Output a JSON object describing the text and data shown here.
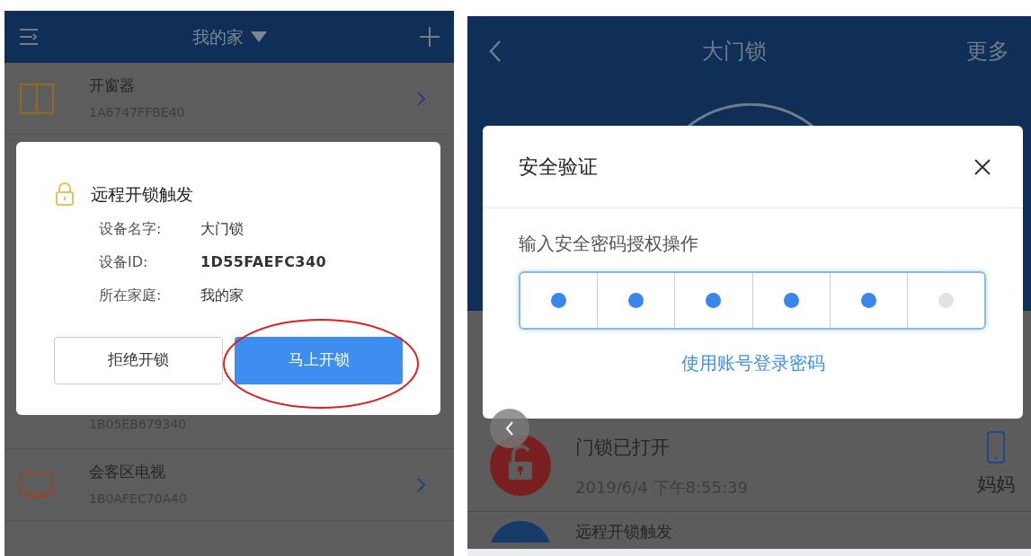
{
  "left_screen": {
    "header": {
      "title": "我的家"
    },
    "devices": [
      {
        "kind": "window",
        "name": "开窗器",
        "id": "1A6747FFBE40"
      },
      {
        "kind": "covered",
        "id": "1B05EB679340"
      },
      {
        "kind": "tv",
        "name": "会客区电视",
        "id": "1B0AFEC70A40"
      }
    ],
    "dialog": {
      "title": "远程开锁触发",
      "fields": [
        {
          "label": "设备名字:",
          "value": "大门锁",
          "bold": false
        },
        {
          "label": "设备ID:",
          "value": "1D55FAEFC340",
          "bold": true
        },
        {
          "label": "所在家庭:",
          "value": "我的家",
          "bold": false
        }
      ],
      "reject_button": "拒绝开锁",
      "accept_button": "马上开锁"
    }
  },
  "right_screen": {
    "header": {
      "title": "大门锁",
      "more": "更多"
    },
    "dialog": {
      "title": "安全验证",
      "prompt": "输入安全密码授权操作",
      "pin": [
        {
          "filled": true
        },
        {
          "filled": true
        },
        {
          "filled": true
        },
        {
          "filled": true
        },
        {
          "filled": true
        },
        {
          "filled": false
        }
      ],
      "link": "使用账号登录密码"
    },
    "events": [
      {
        "kind": "unlocked",
        "title": "门锁已打开",
        "time": "2019/6/4 下午8:55:39",
        "user": "妈妈"
      },
      {
        "kind": "remote",
        "title": "远程开锁触发"
      }
    ]
  }
}
